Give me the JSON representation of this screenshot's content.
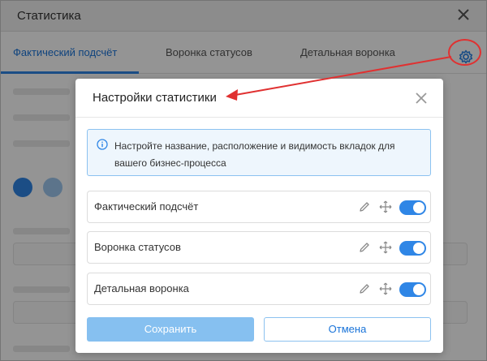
{
  "window": {
    "title": "Статистика",
    "tabs": [
      {
        "label": "Фактический подсчёт",
        "active": true
      },
      {
        "label": "Воронка статусов",
        "active": false
      },
      {
        "label": "Детальная воронка",
        "active": false
      }
    ],
    "icons": {
      "close": "close-icon",
      "settings": "gear-icon"
    }
  },
  "modal": {
    "title": "Настройки статистики",
    "info_text": "Настройте название, расположение и видимость вкладок для вашего бизнес-процесса",
    "rows": [
      {
        "label": "Фактический подсчёт",
        "enabled": true
      },
      {
        "label": "Воронка статусов",
        "enabled": true
      },
      {
        "label": "Детальная воронка",
        "enabled": true
      }
    ],
    "save_label": "Сохранить",
    "cancel_label": "Отмена"
  },
  "colors": {
    "accent": "#2f86e6",
    "annotation": "#e03131",
    "save_disabled": "#86c0f0"
  }
}
